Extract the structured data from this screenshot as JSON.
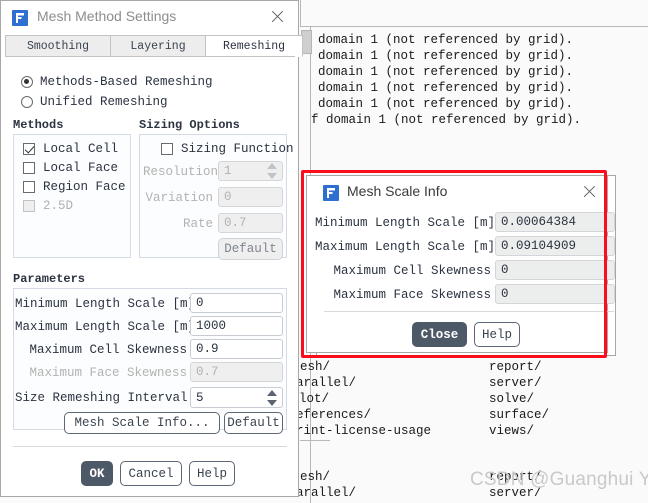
{
  "console": {
    "lines_top": [
      "domain 1 (not referenced by grid).",
      "domain 1 (not referenced by grid).",
      "domain 1 (not referenced by grid).",
      "domain 1 (not referenced by grid).",
      "domain 1 (not referenced by grid).",
      "f domain 1 (not referenced by grid)."
    ],
    "col_left_1": [
      "esh/",
      "arallel/",
      "lot/",
      "eferences/",
      "rint-license-usage"
    ],
    "col_right_1": [
      "report/",
      "server/",
      "solve/",
      "surface/",
      "views/"
    ],
    "col_left_2": [
      "esh/",
      "arallel/"
    ],
    "col_right_2": [
      "report/",
      "server/"
    ],
    "watermark": "CSDN @Guanghui Yu"
  },
  "mesh_method_window": {
    "title": "Mesh Method Settings",
    "icon": "fluent-app-icon",
    "close_icon": "close-icon",
    "tabs": [
      {
        "label": "Smoothing",
        "active": false
      },
      {
        "label": "Layering",
        "active": false
      },
      {
        "label": "Remeshing",
        "active": true
      }
    ],
    "remesh_mode": {
      "options": [
        {
          "label": "Methods-Based Remeshing",
          "selected": true
        },
        {
          "label": "Unified Remeshing",
          "selected": false
        }
      ]
    },
    "methods_group": {
      "title": "Methods",
      "items": [
        {
          "label": "Local Cell",
          "checked": true,
          "enabled": true
        },
        {
          "label": "Local Face",
          "checked": false,
          "enabled": true
        },
        {
          "label": "Region Face",
          "checked": false,
          "enabled": true
        },
        {
          "label": "2.5D",
          "checked": false,
          "enabled": false
        }
      ]
    },
    "sizing_group": {
      "title": "Sizing Options",
      "sizing_function": {
        "label": "Sizing Function",
        "checked": false
      },
      "fields": [
        {
          "label": "Resolution",
          "value": "1",
          "enabled": false,
          "spinner": true
        },
        {
          "label": "Variation",
          "value": "0",
          "enabled": false,
          "spinner": false
        },
        {
          "label": "Rate",
          "value": "0.7",
          "enabled": false,
          "spinner": false
        }
      ],
      "default_button": "Default"
    },
    "parameters_group": {
      "title": "Parameters",
      "fields": [
        {
          "label": "Minimum Length Scale [m]",
          "value": "0",
          "enabled": true,
          "spinner": false
        },
        {
          "label": "Maximum Length Scale [m]",
          "value": "1000",
          "enabled": true,
          "spinner": false
        },
        {
          "label": "Maximum Cell Skewness",
          "value": "0.9",
          "enabled": true,
          "spinner": false
        },
        {
          "label": "Maximum Face Skewness",
          "value": "0.7",
          "enabled": false,
          "spinner": false
        },
        {
          "label": "Size Remeshing Interval",
          "value": "5",
          "enabled": true,
          "spinner": true
        }
      ],
      "mesh_scale_info_button": "Mesh Scale Info...",
      "default_button": "Default"
    },
    "footer_buttons": [
      {
        "label": "OK",
        "primary": true
      },
      {
        "label": "Cancel",
        "primary": false
      },
      {
        "label": "Help",
        "primary": false
      }
    ]
  },
  "mesh_scale_info_dialog": {
    "title": "Mesh Scale Info",
    "icon": "fluent-app-icon",
    "close_icon": "close-icon",
    "fields": [
      {
        "label": "Minimum Length Scale [m]",
        "value": "0.00064384"
      },
      {
        "label": "Maximum Length Scale [m]",
        "value": "0.09104909"
      },
      {
        "label": "Maximum Cell Skewness",
        "value": "0"
      },
      {
        "label": "Maximum Face Skewness",
        "value": "0"
      }
    ],
    "buttons": [
      {
        "label": "Close",
        "primary": true
      },
      {
        "label": "Help",
        "primary": false
      }
    ],
    "highlight_color": "#fc0d1b"
  }
}
